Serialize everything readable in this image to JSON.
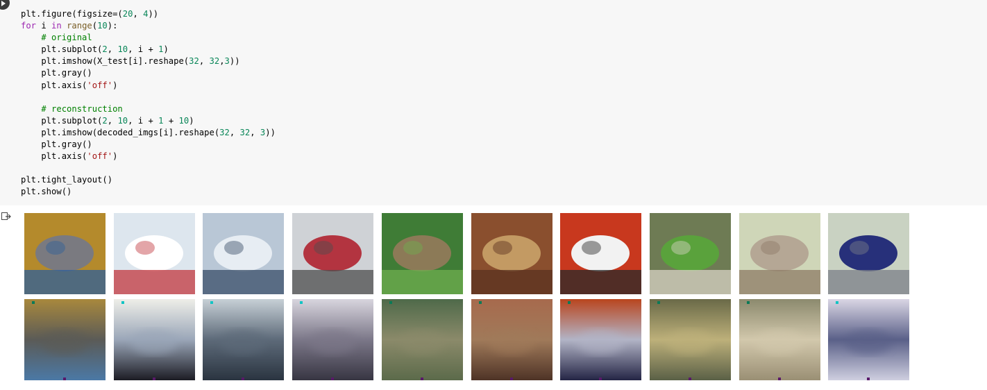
{
  "code_lines": [
    [
      {
        "t": "plt.figure(figsize=(",
        "c": ""
      },
      {
        "t": "20",
        "c": "num"
      },
      {
        "t": ", ",
        "c": ""
      },
      {
        "t": "4",
        "c": "num"
      },
      {
        "t": "))",
        "c": ""
      }
    ],
    [
      {
        "t": "for",
        "c": "kw"
      },
      {
        "t": " i ",
        "c": ""
      },
      {
        "t": "in",
        "c": "kw"
      },
      {
        "t": " ",
        "c": ""
      },
      {
        "t": "range",
        "c": "bi"
      },
      {
        "t": "(",
        "c": ""
      },
      {
        "t": "10",
        "c": "num"
      },
      {
        "t": "):",
        "c": ""
      }
    ],
    [
      {
        "t": "    ",
        "c": ""
      },
      {
        "t": "# original",
        "c": "cm"
      }
    ],
    [
      {
        "t": "    plt.subplot(",
        "c": ""
      },
      {
        "t": "2",
        "c": "num"
      },
      {
        "t": ", ",
        "c": ""
      },
      {
        "t": "10",
        "c": "num"
      },
      {
        "t": ", i + ",
        "c": ""
      },
      {
        "t": "1",
        "c": "num"
      },
      {
        "t": ")",
        "c": ""
      }
    ],
    [
      {
        "t": "    plt.imshow(X_test[i].reshape(",
        "c": ""
      },
      {
        "t": "32",
        "c": "num"
      },
      {
        "t": ", ",
        "c": ""
      },
      {
        "t": "32",
        "c": "num"
      },
      {
        "t": ",",
        "c": ""
      },
      {
        "t": "3",
        "c": "num"
      },
      {
        "t": "))",
        "c": ""
      }
    ],
    [
      {
        "t": "    plt.gray()",
        "c": ""
      }
    ],
    [
      {
        "t": "    plt.axis(",
        "c": ""
      },
      {
        "t": "'off'",
        "c": "str"
      },
      {
        "t": ")",
        "c": ""
      }
    ],
    [
      {
        "t": "",
        "c": ""
      }
    ],
    [
      {
        "t": "    ",
        "c": ""
      },
      {
        "t": "# reconstruction",
        "c": "cm"
      }
    ],
    [
      {
        "t": "    plt.subplot(",
        "c": ""
      },
      {
        "t": "2",
        "c": "num"
      },
      {
        "t": ", ",
        "c": ""
      },
      {
        "t": "10",
        "c": "num"
      },
      {
        "t": ", i + ",
        "c": ""
      },
      {
        "t": "1",
        "c": "num"
      },
      {
        "t": " + ",
        "c": ""
      },
      {
        "t": "10",
        "c": "num"
      },
      {
        "t": ")",
        "c": ""
      }
    ],
    [
      {
        "t": "    plt.imshow(decoded_imgs[i].reshape(",
        "c": ""
      },
      {
        "t": "32",
        "c": "num"
      },
      {
        "t": ", ",
        "c": ""
      },
      {
        "t": "32",
        "c": "num"
      },
      {
        "t": ", ",
        "c": ""
      },
      {
        "t": "3",
        "c": "num"
      },
      {
        "t": "))",
        "c": ""
      }
    ],
    [
      {
        "t": "    plt.gray()",
        "c": ""
      }
    ],
    [
      {
        "t": "    plt.axis(",
        "c": ""
      },
      {
        "t": "'off'",
        "c": "str"
      },
      {
        "t": ")",
        "c": ""
      }
    ],
    [
      {
        "t": "",
        "c": ""
      }
    ],
    [
      {
        "t": "plt.tight_layout()",
        "c": ""
      }
    ],
    [
      {
        "t": "plt.show()",
        "c": ""
      }
    ]
  ],
  "output": {
    "originals": [
      {
        "subject": "cat",
        "bg": "#b48a2c",
        "c1": "#7a7a80",
        "c2": "#2f5f9a"
      },
      {
        "subject": "ship",
        "bg": "#dde6ee",
        "c1": "#ffffff",
        "c2": "#c1373d"
      },
      {
        "subject": "ship",
        "bg": "#b9c7d6",
        "c1": "#e7edf3",
        "c2": "#3a4e68"
      },
      {
        "subject": "airplane",
        "bg": "#cfd2d6",
        "c1": "#b33440",
        "c2": "#4d4d4d"
      },
      {
        "subject": "frog",
        "bg": "#3f7c36",
        "c1": "#8c7a57",
        "c2": "#6fae4f"
      },
      {
        "subject": "frog",
        "bg": "#8a4f2e",
        "c1": "#c39a63",
        "c2": "#5a3120"
      },
      {
        "subject": "automobile",
        "bg": "#c8381e",
        "c1": "#f2f2f2",
        "c2": "#2a2a2a"
      },
      {
        "subject": "frog",
        "bg": "#6e7b54",
        "c1": "#5aa23c",
        "c2": "#d8d2c4"
      },
      {
        "subject": "cat",
        "bg": "#cfd6b8",
        "c1": "#b5a795",
        "c2": "#8d7b66"
      },
      {
        "subject": "automobile",
        "bg": "#c9d2c2",
        "c1": "#27307a",
        "c2": "#7b7f88"
      }
    ],
    "reconstructions": [
      {
        "top": "#a8883d",
        "mid": "#5b5b57",
        "bot": "#4b79a6",
        "dot": "#0b7a57"
      },
      {
        "top": "#eeeee8",
        "mid": "#9aa6b8",
        "bot": "#1c1c24",
        "dot": "#13c4c4"
      },
      {
        "top": "#c7d0d6",
        "mid": "#5d6a79",
        "bot": "#2a3440",
        "dot": "#13c4c4"
      },
      {
        "top": "#d8d5de",
        "mid": "#7b7788",
        "bot": "#373542",
        "dot": "#13c4c4"
      },
      {
        "top": "#4f6a4a",
        "mid": "#8b8a6a",
        "bot": "#5b6a4a",
        "dot": "#0b7a57"
      },
      {
        "top": "#a76a4d",
        "mid": "#a07a5a",
        "bot": "#4e3326",
        "dot": "#0b7a57"
      },
      {
        "top": "#b9451e",
        "mid": "#b2b4c6",
        "bot": "#242545",
        "dot": "#0b7a57"
      },
      {
        "top": "#6a6a48",
        "mid": "#bdb07a",
        "bot": "#5a6046",
        "dot": "#0b7a57"
      },
      {
        "top": "#8c8a6e",
        "mid": "#d2c8ac",
        "bot": "#9a8f74",
        "dot": "#0b7a57"
      },
      {
        "top": "#dad6e4",
        "mid": "#5a6088",
        "bot": "#cfcfe0",
        "dot": "#13c4c4"
      }
    ]
  }
}
